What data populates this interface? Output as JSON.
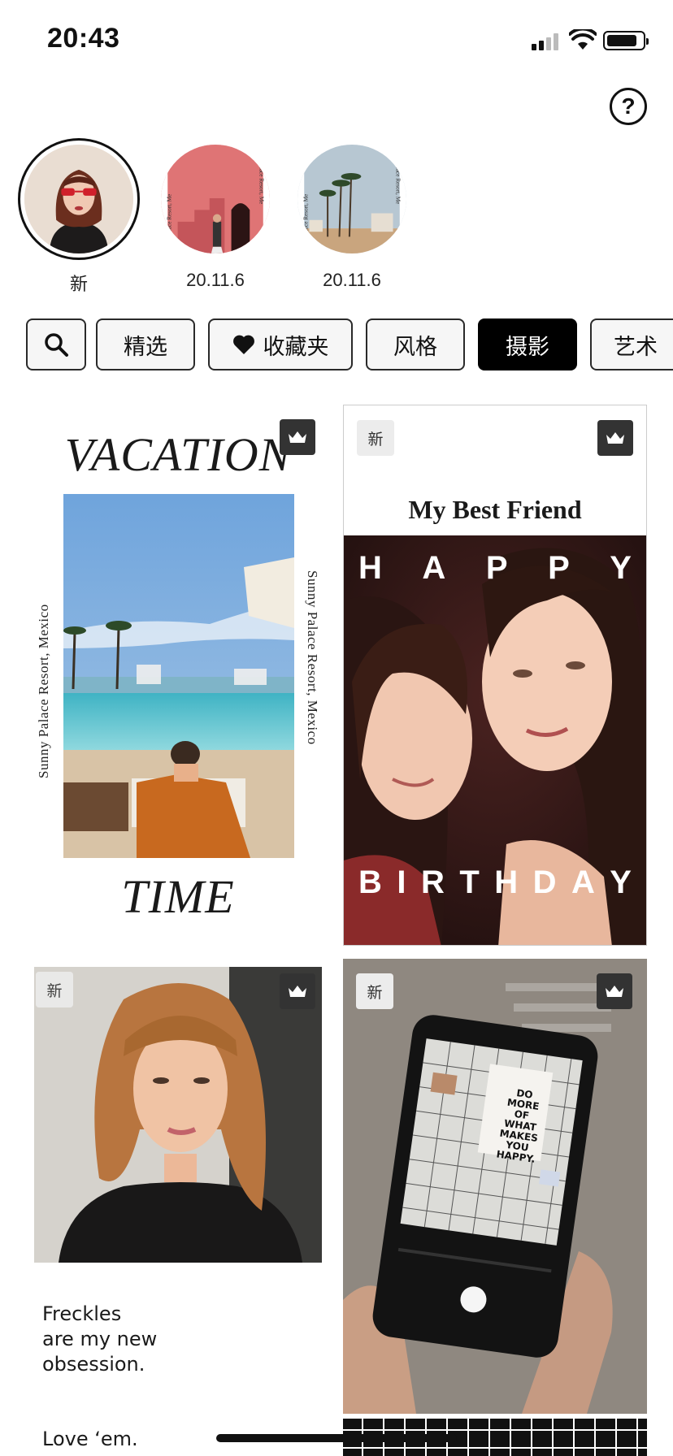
{
  "status_bar": {
    "time": "20:43"
  },
  "help_icon": "?",
  "stories": [
    {
      "label": "新",
      "selected": true
    },
    {
      "label": "20.11.6",
      "selected": false
    },
    {
      "label": "20.11.6",
      "selected": false
    }
  ],
  "filters": {
    "search_icon": "search-icon",
    "items": [
      "精选",
      "收藏夹",
      "风格",
      "摄影",
      "艺术"
    ],
    "active": "摄影"
  },
  "cards": {
    "vacation": {
      "title_top": "VACATION",
      "title_bottom": "TIME",
      "side_text": "Sunny Palace Resort, Mexico"
    },
    "birthday": {
      "badge": "新",
      "heading": "My Best Friend",
      "line1": [
        "H",
        "A",
        "P",
        "P",
        "Y"
      ],
      "line2": [
        "B",
        "I",
        "R",
        "T",
        "H",
        "D",
        "A",
        "Y"
      ]
    },
    "freckles": {
      "badge": "新",
      "lines": [
        "Freckles",
        "are my new",
        "obsession."
      ],
      "footer": "Love ‘em."
    },
    "phone": {
      "badge": "新",
      "note_text": [
        "DO",
        "MORE",
        "OF",
        "WHAT",
        "MAKES",
        "YOU",
        "HAPPY."
      ]
    }
  },
  "colors": {
    "accent": "#000000",
    "chip_bg": "#f6f6f6",
    "badge_dark": "#333333"
  }
}
